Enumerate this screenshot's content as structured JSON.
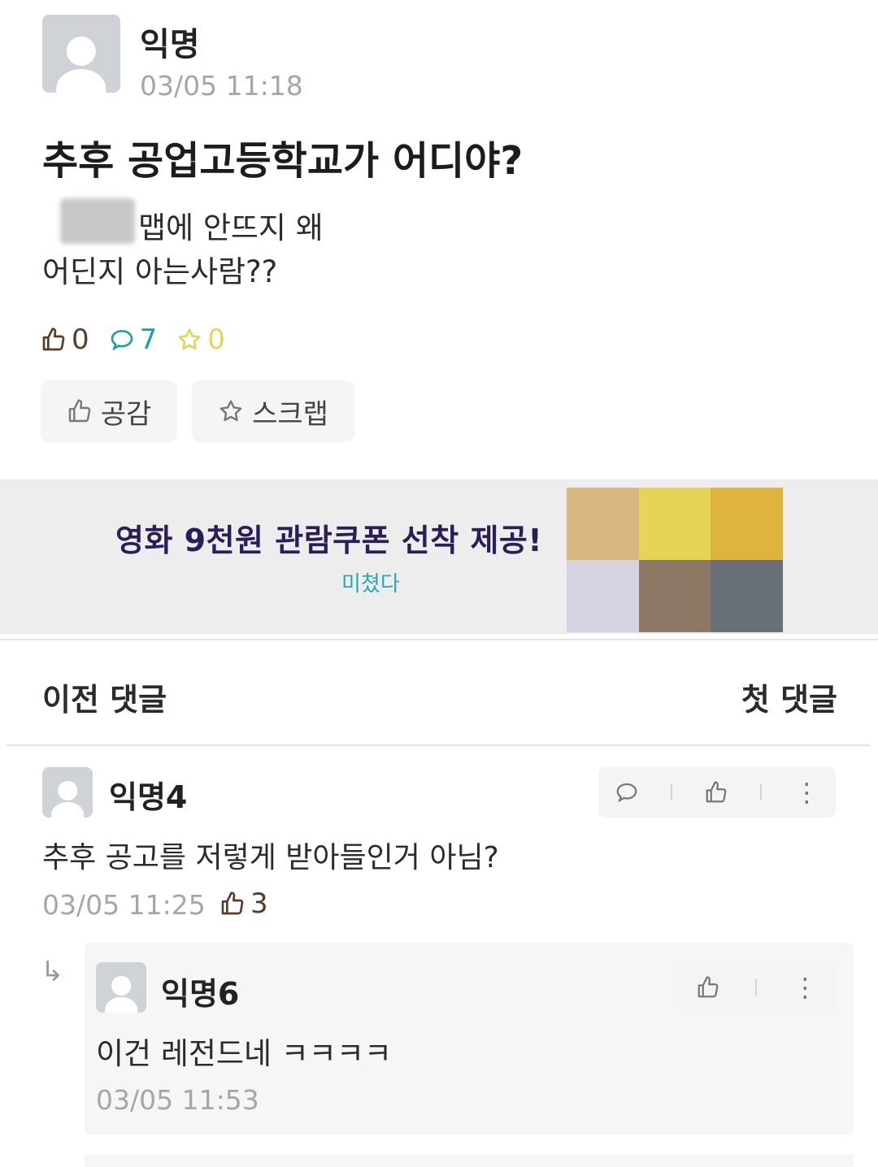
{
  "post": {
    "author": "익명",
    "time": "03/05 11:18",
    "title": "추후 공업고등학교가 어디야?",
    "body_line1": "맵에 안뜨지 왜",
    "body_line2": "어딘지 아는사람??",
    "stats": {
      "likes": "0",
      "comments": "7",
      "scraps": "0"
    },
    "like_button_label": "공감",
    "scrap_button_label": "스크랩"
  },
  "ad": {
    "title": "영화 9천원 관람쿠폰 선착 제공!",
    "subtitle": "미쳤다",
    "mosaic_colors": [
      "#d8b880",
      "#e6d457",
      "#dfb43e",
      "#d6d3e0",
      "#8c7865",
      "#6a7077"
    ]
  },
  "comment_nav": {
    "prev_label": "이전 댓글",
    "first_label": "첫 댓글"
  },
  "comments": [
    {
      "author": "익명4",
      "text": "추후 공고를 저렇게 받아들인거 아님?",
      "time": "03/05 11:25",
      "likes": "3",
      "replies": [
        {
          "author": "익명6",
          "text": "이건 레전드네 ㅋㅋㅋㅋ",
          "time": "03/05 11:53"
        }
      ]
    }
  ],
  "icons": {
    "thumbs_up": "thumbs-up-icon",
    "comment": "comment-bubble-icon",
    "star": "star-icon",
    "reply_arrow": "reply-arrow-icon",
    "more": "more-vertical-icon"
  },
  "colors": {
    "like": "#5a3b28",
    "comment": "#1e9fa8",
    "scrap": "#e3d55c",
    "meta_gray": "#a6a6a6",
    "ad_title": "#2b1d57"
  }
}
